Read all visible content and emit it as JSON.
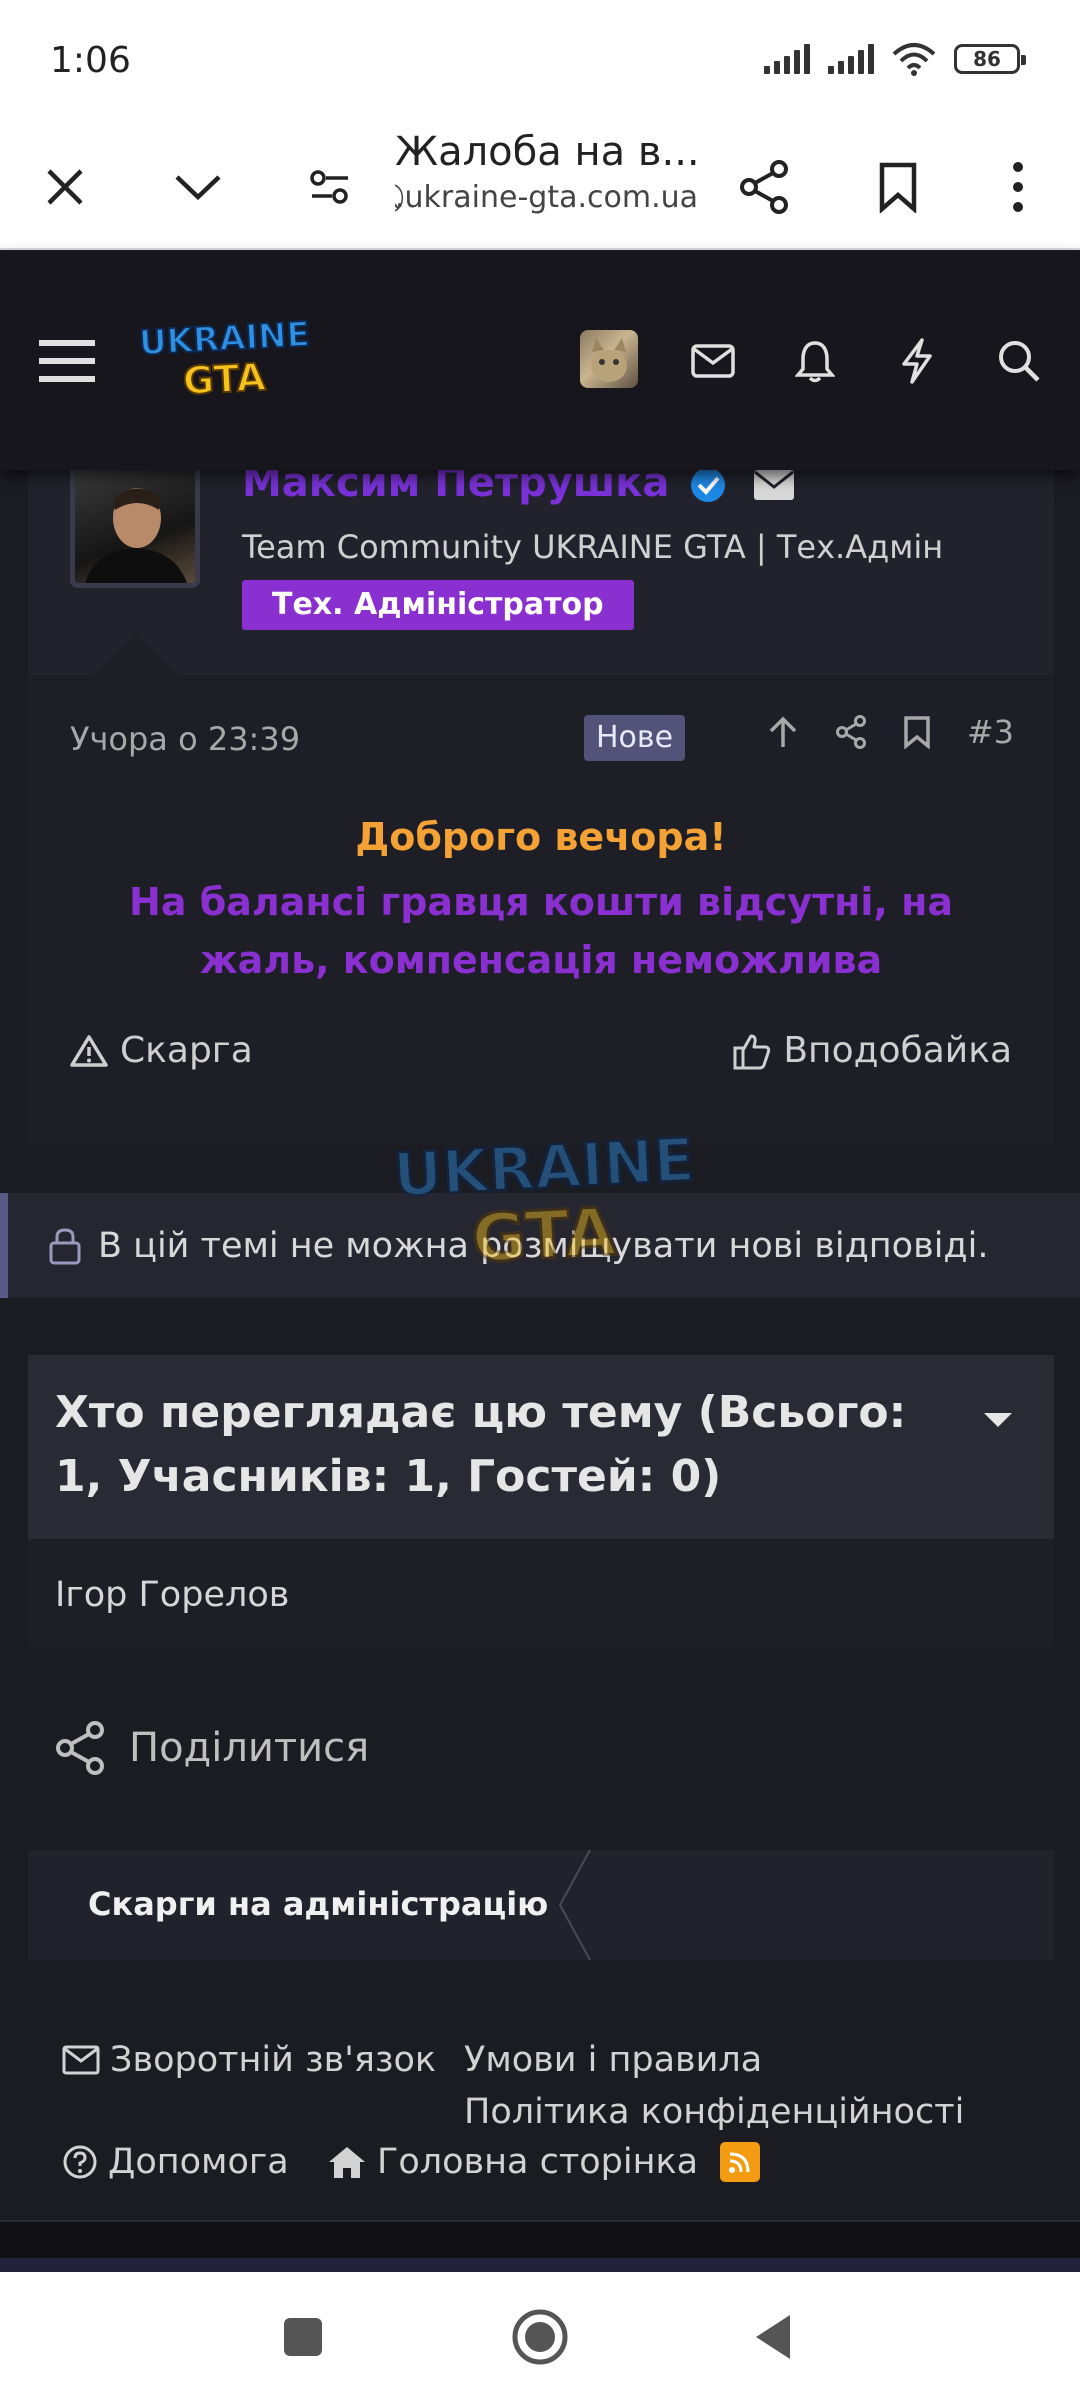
{
  "status_bar": {
    "time": "1:06",
    "battery": "86"
  },
  "browser": {
    "title": "Жалоба на в...",
    "url": "⃠.ukraine-gta.com.ua"
  },
  "site": {
    "logo_text_1": "UKRAINE",
    "logo_text_2": "GTA"
  },
  "post": {
    "user_name": "Максим Петрушка",
    "user_title": "Team Community UKRAINE GTA | Тех.Адмін",
    "user_badge": "Тех. Адміністратор",
    "date": "Учора о 23:39",
    "new_label": "Нове",
    "post_number": "#3",
    "message_line1": "Доброго вечора!",
    "message_line2": "На балансі гравця кошти відсутні, на жаль, компенсація неможлива",
    "report_label": "Скарга",
    "like_label": "Вподобайка"
  },
  "locked_notice": "В цій темі не можна розміщувати нові відповіді.",
  "viewers": {
    "title": "Хто переглядає цю тему (Всього: 1, Учасників: 1, Гостей: 0)",
    "names": [
      "Ігор Горелов"
    ]
  },
  "share_label": "Поділитися",
  "breadcrumb": "Скарги на адміністрацію",
  "footer": {
    "contact": "Зворотній зв'язок",
    "terms": "Умови і правила",
    "privacy": "Політика конфіденційності",
    "help": "Допомога",
    "home": "Головна сторінка"
  },
  "colors": {
    "accent_purple": "#8a2fd0",
    "greeting_orange": "#f4a236",
    "background": "#1b1b22"
  }
}
